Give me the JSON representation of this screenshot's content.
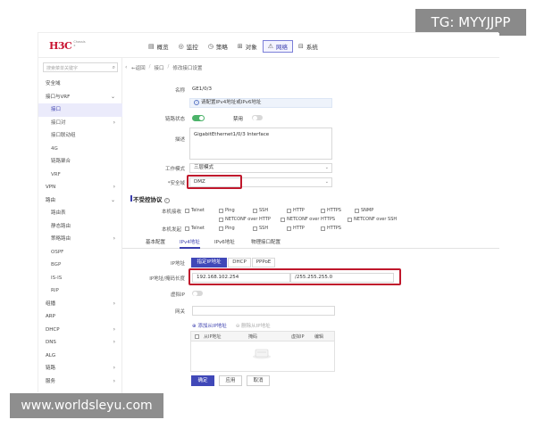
{
  "logo": {
    "mark": "H3C",
    "sub": "Chassis x"
  },
  "nav": [
    {
      "label": "概览",
      "icon": "▤"
    },
    {
      "label": "监控",
      "icon": "◎"
    },
    {
      "label": "策略",
      "icon": "◷"
    },
    {
      "label": "对象",
      "icon": "⊞"
    },
    {
      "label": "网络",
      "icon": "⚠",
      "active": true
    },
    {
      "label": "系统",
      "icon": "⊟"
    }
  ],
  "sidebar": {
    "search_placeholder": "搜索菜单关键字",
    "items": [
      {
        "label": "安全域"
      },
      {
        "label": "接口与VRF"
      },
      {
        "label": "接口"
      },
      {
        "label": "接口对"
      },
      {
        "label": "接口联动组"
      },
      {
        "label": "4G"
      },
      {
        "label": "链路聚合"
      },
      {
        "label": "VRF"
      },
      {
        "label": "VPN"
      },
      {
        "label": "路由"
      },
      {
        "label": "路由表"
      },
      {
        "label": "静态路由"
      },
      {
        "label": "策略路由"
      },
      {
        "label": "OSPF"
      },
      {
        "label": "BGP"
      },
      {
        "label": "IS-IS"
      },
      {
        "label": "RIP"
      },
      {
        "label": "组播"
      },
      {
        "label": "ARP"
      },
      {
        "label": "DHCP"
      },
      {
        "label": "DNS"
      },
      {
        "label": "ALG"
      },
      {
        "label": "链路"
      },
      {
        "label": "服务"
      }
    ]
  },
  "breadcrumb": {
    "back": "←返回",
    "level1": "接口",
    "level2": "修改接口设置",
    "sep": "/"
  },
  "form": {
    "name_label": "名称",
    "name_value": "GE1/0/3",
    "info_text": "请配置IPv4地址或IPv6地址",
    "link_state_label": "链路状态",
    "link_state_on": "开启",
    "link_state_off": "禁用",
    "desc_label": "描述",
    "desc_value": "GigabitEthernet1/0/3 Interface",
    "work_mode_label": "工作模式",
    "work_mode_value": "三层模式",
    "zone_label": "*安全域",
    "zone_value": "DMZ"
  },
  "protocol": {
    "title": "不受控协议",
    "local_access_label": "本机接收",
    "local_send_label": "本机发起",
    "row1": [
      "Telnet",
      "Ping",
      "SSH",
      "HTTP",
      "HTTPS",
      "SNMP"
    ],
    "row2": [
      "NETCONF over HTTP",
      "NETCONF over HTTPS",
      "NETCONF over SSH"
    ],
    "row3": [
      "Telnet",
      "Ping",
      "SSH",
      "HTTP",
      "HTTPS"
    ]
  },
  "tabs": [
    "基本配置",
    "IPv4地址",
    "IPv6地址",
    "物理接口配置"
  ],
  "ipv4": {
    "ip_label": "IP地址",
    "modes": [
      "指定IP地址",
      "DHCP",
      "PPPoE"
    ],
    "addr_label": "IP地址/掩码长度",
    "ip_value": "192.168.102.254",
    "mask_value": "/255.255.255.0",
    "virtual_ip_label": "虚拟IP",
    "gateway_label": "网关",
    "add_sub": "添加从IP地址",
    "del_sub": "删除从IP地址",
    "columns": [
      "从IP地址",
      "掩码",
      "虚拟IP",
      "编辑"
    ]
  },
  "buttons": {
    "ok": "确定",
    "apply": "应用",
    "cancel": "取消"
  },
  "watermarks": {
    "top": "TG: MYYJJPP",
    "bottom": "www.worldsleyu.com"
  },
  "colors": {
    "accent": "#4048b8",
    "highlight": "#c0182c",
    "toggle_on": "#4cb36a"
  }
}
